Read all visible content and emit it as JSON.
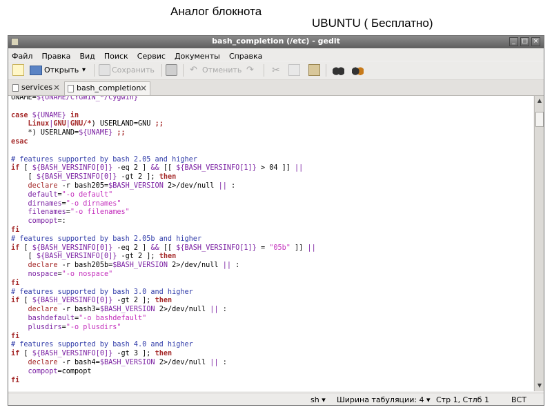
{
  "slide": {
    "title": "Аналог блокнота",
    "subtitle": "UBUNTU ( Бесплатно)"
  },
  "window": {
    "title": "bash_completion (/etc) - gedit"
  },
  "menu": [
    "Файл",
    "Правка",
    "Вид",
    "Поиск",
    "Сервис",
    "Документы",
    "Справка"
  ],
  "toolbar": {
    "open_label": "Открыть",
    "save_label": "Сохранить",
    "undo_label": "Отменить"
  },
  "tabs": [
    {
      "label": "services",
      "active": false
    },
    {
      "label": "bash_completion",
      "active": true
    }
  ],
  "colors": {
    "keyword": "#a52a2a",
    "variable": "#7a1fa2",
    "string": "#c42fbd",
    "comment": "#2e3aa8",
    "plain": "#000000",
    "operator": "#7a1fa2",
    "builtin": "#a52a2a"
  },
  "code_lines": [
    [
      [
        "plain",
        "UNAME="
      ],
      [
        "variable",
        "${UNAME/CYGWIN_*/Cygwin}"
      ]
    ],
    [],
    [
      [
        "keyword",
        "case "
      ],
      [
        "variable",
        "${UNAME}"
      ],
      [
        "keyword",
        " in"
      ]
    ],
    [
      [
        "plain",
        "    "
      ],
      [
        "keyword",
        "Linux"
      ],
      [
        "operator",
        "|"
      ],
      [
        "keyword",
        "GNU"
      ],
      [
        "operator",
        "|"
      ],
      [
        "keyword",
        "GNU/*"
      ],
      [
        "plain",
        ") USERLAND=GNU "
      ],
      [
        "keyword",
        ";;"
      ]
    ],
    [
      [
        "plain",
        "    *) USERLAND="
      ],
      [
        "variable",
        "${UNAME}"
      ],
      [
        "keyword",
        " ;;"
      ]
    ],
    [
      [
        "keyword",
        "esac"
      ]
    ],
    [],
    [
      [
        "comment",
        "# features supported by bash 2.05 and higher"
      ]
    ],
    [
      [
        "keyword",
        "if"
      ],
      [
        "plain",
        " [ "
      ],
      [
        "variable",
        "${BASH_VERSINFO[0]}"
      ],
      [
        "plain",
        " -eq 2 ] "
      ],
      [
        "operator",
        "&&"
      ],
      [
        "plain",
        " [[ "
      ],
      [
        "variable",
        "${BASH_VERSINFO[1]}"
      ],
      [
        "plain",
        " > 04 ]] "
      ],
      [
        "operator",
        "||"
      ]
    ],
    [
      [
        "plain",
        "    [ "
      ],
      [
        "variable",
        "${BASH_VERSINFO[0]}"
      ],
      [
        "plain",
        " -gt 2 ]; "
      ],
      [
        "keyword",
        "then"
      ]
    ],
    [
      [
        "plain",
        "    "
      ],
      [
        "builtin",
        "declare"
      ],
      [
        "plain",
        " -r bash205="
      ],
      [
        "variable",
        "$BASH_VERSION"
      ],
      [
        "plain",
        " 2>/dev/null "
      ],
      [
        "operator",
        "||"
      ],
      [
        "plain",
        " :"
      ]
    ],
    [
      [
        "plain",
        "    "
      ],
      [
        "variable",
        "default"
      ],
      [
        "plain",
        "="
      ],
      [
        "string",
        "\"-o default\""
      ]
    ],
    [
      [
        "plain",
        "    "
      ],
      [
        "variable",
        "dirnames"
      ],
      [
        "plain",
        "="
      ],
      [
        "string",
        "\"-o dirnames\""
      ]
    ],
    [
      [
        "plain",
        "    "
      ],
      [
        "variable",
        "filenames"
      ],
      [
        "plain",
        "="
      ],
      [
        "string",
        "\"-o filenames\""
      ]
    ],
    [
      [
        "plain",
        "    "
      ],
      [
        "variable",
        "compopt"
      ],
      [
        "plain",
        "=:"
      ]
    ],
    [
      [
        "keyword",
        "fi"
      ]
    ],
    [
      [
        "comment",
        "# features supported by bash 2.05b and higher"
      ]
    ],
    [
      [
        "keyword",
        "if"
      ],
      [
        "plain",
        " [ "
      ],
      [
        "variable",
        "${BASH_VERSINFO[0]}"
      ],
      [
        "plain",
        " -eq 2 ] "
      ],
      [
        "operator",
        "&&"
      ],
      [
        "plain",
        " [[ "
      ],
      [
        "variable",
        "${BASH_VERSINFO[1]}"
      ],
      [
        "plain",
        " = "
      ],
      [
        "string",
        "\"05b\""
      ],
      [
        "plain",
        " ]] "
      ],
      [
        "operator",
        "||"
      ]
    ],
    [
      [
        "plain",
        "    [ "
      ],
      [
        "variable",
        "${BASH_VERSINFO[0]}"
      ],
      [
        "plain",
        " -gt 2 ]; "
      ],
      [
        "keyword",
        "then"
      ]
    ],
    [
      [
        "plain",
        "    "
      ],
      [
        "builtin",
        "declare"
      ],
      [
        "plain",
        " -r bash205b="
      ],
      [
        "variable",
        "$BASH_VERSION"
      ],
      [
        "plain",
        " 2>/dev/null "
      ],
      [
        "operator",
        "||"
      ],
      [
        "plain",
        " :"
      ]
    ],
    [
      [
        "plain",
        "    "
      ],
      [
        "variable",
        "nospace"
      ],
      [
        "plain",
        "="
      ],
      [
        "string",
        "\"-o nospace\""
      ]
    ],
    [
      [
        "keyword",
        "fi"
      ]
    ],
    [
      [
        "comment",
        "# features supported by bash 3.0 and higher"
      ]
    ],
    [
      [
        "keyword",
        "if"
      ],
      [
        "plain",
        " [ "
      ],
      [
        "variable",
        "${BASH_VERSINFO[0]}"
      ],
      [
        "plain",
        " -gt 2 ]; "
      ],
      [
        "keyword",
        "then"
      ]
    ],
    [
      [
        "plain",
        "    "
      ],
      [
        "builtin",
        "declare"
      ],
      [
        "plain",
        " -r bash3="
      ],
      [
        "variable",
        "$BASH_VERSION"
      ],
      [
        "plain",
        " 2>/dev/null "
      ],
      [
        "operator",
        "||"
      ],
      [
        "plain",
        " :"
      ]
    ],
    [
      [
        "plain",
        "    "
      ],
      [
        "variable",
        "bashdefault"
      ],
      [
        "plain",
        "="
      ],
      [
        "string",
        "\"-o bashdefault\""
      ]
    ],
    [
      [
        "plain",
        "    "
      ],
      [
        "variable",
        "plusdirs"
      ],
      [
        "plain",
        "="
      ],
      [
        "string",
        "\"-o plusdirs\""
      ]
    ],
    [
      [
        "keyword",
        "fi"
      ]
    ],
    [
      [
        "comment",
        "# features supported by bash 4.0 and higher"
      ]
    ],
    [
      [
        "keyword",
        "if"
      ],
      [
        "plain",
        " [ "
      ],
      [
        "variable",
        "${BASH_VERSINFO[0]}"
      ],
      [
        "plain",
        " -gt 3 ]; "
      ],
      [
        "keyword",
        "then"
      ]
    ],
    [
      [
        "plain",
        "    "
      ],
      [
        "builtin",
        "declare"
      ],
      [
        "plain",
        " -r bash4="
      ],
      [
        "variable",
        "$BASH_VERSION"
      ],
      [
        "plain",
        " 2>/dev/null "
      ],
      [
        "operator",
        "||"
      ],
      [
        "plain",
        " :"
      ]
    ],
    [
      [
        "plain",
        "    "
      ],
      [
        "variable",
        "compopt"
      ],
      [
        "plain",
        "=compopt"
      ]
    ],
    [
      [
        "keyword",
        "fi"
      ]
    ]
  ],
  "statusbar": {
    "language": "sh ▾",
    "tab_width": "Ширина табуляции:  4 ▾",
    "position": "Стр 1, Стлб 1",
    "mode": "ВСТ"
  }
}
